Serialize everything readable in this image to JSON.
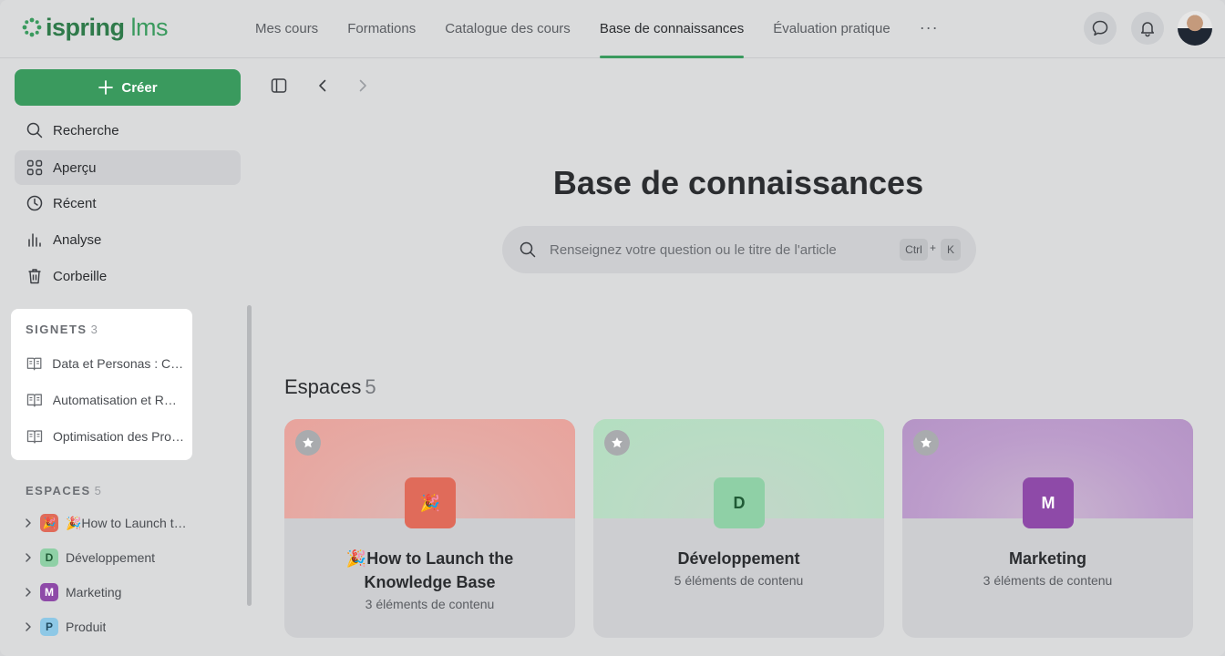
{
  "brand": {
    "part1": "ispring",
    "part2": "lms",
    "color": "#3a9a5e"
  },
  "nav": {
    "items": [
      {
        "label": "Mes cours"
      },
      {
        "label": "Formations"
      },
      {
        "label": "Catalogue des cours"
      },
      {
        "label": "Base de connaissances",
        "active": true
      },
      {
        "label": "Évaluation pratique"
      }
    ],
    "more": "···"
  },
  "sidebar": {
    "create_label": "Créer",
    "items": [
      {
        "label": "Recherche",
        "icon": "search-icon"
      },
      {
        "label": "Aperçu",
        "icon": "grid-icon",
        "active": true
      },
      {
        "label": "Récent",
        "icon": "clock-icon"
      },
      {
        "label": "Analyse",
        "icon": "bar-chart-icon"
      },
      {
        "label": "Corbeille",
        "icon": "trash-icon"
      }
    ],
    "bookmarks": {
      "title": "SIGNETS",
      "count": "3",
      "items": [
        {
          "label": "Data et Personas : Co…"
        },
        {
          "label": "Automatisation et RO…"
        },
        {
          "label": "Optimisation des Pro…"
        }
      ]
    },
    "spaces": {
      "title": "ESPACES",
      "count": "5",
      "items": [
        {
          "label": "🎉How to Launch th…",
          "badge": "🎉",
          "color": "#e06b5a"
        },
        {
          "label": "Développement",
          "badge": "D",
          "color": "#8fd0a6"
        },
        {
          "label": "Marketing",
          "badge": "M",
          "color": "#8e4aa8"
        },
        {
          "label": "Produit",
          "badge": "P",
          "color": "#8ec8e6"
        }
      ]
    }
  },
  "main": {
    "title": "Base de connaissances",
    "search": {
      "placeholder": "Renseignez votre question ou le titre de l'article",
      "kbd1": "Ctrl",
      "plus": "+",
      "kbd2": "K"
    },
    "spaces_heading": "Espaces",
    "spaces_count": "5",
    "cards": [
      {
        "title_line1": "🎉How to Launch the",
        "title_line2": "Knowledge Base",
        "subtitle": "3 éléments de contenu",
        "icon": "🎉",
        "color": "#e06b5a"
      },
      {
        "title_line1": "Développement",
        "title_line2": "",
        "subtitle": "5 éléments de contenu",
        "icon": "D",
        "color": "#8fd0a6"
      },
      {
        "title_line1": "Marketing",
        "title_line2": "",
        "subtitle": "3 éléments de contenu",
        "icon": "M",
        "color": "#8e4aa8"
      }
    ]
  }
}
